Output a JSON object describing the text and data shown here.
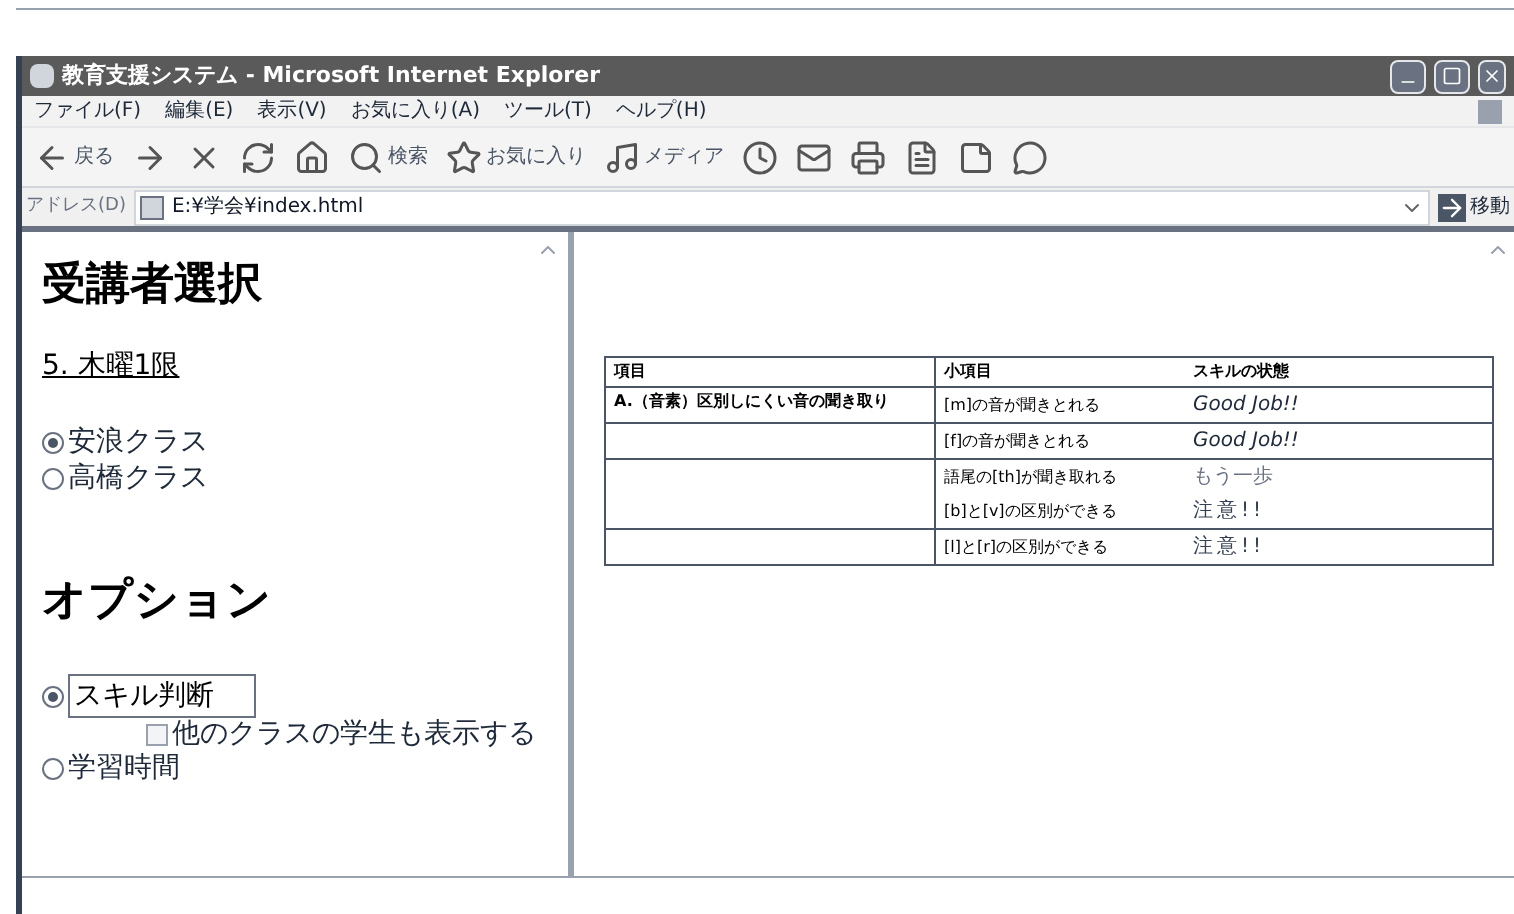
{
  "window": {
    "title": "教育支援システム - Microsoft Internet Explorer"
  },
  "menu": [
    "ファイル(F)",
    "編集(E)",
    "表示(V)",
    "お気に入り(A)",
    "ツール(T)",
    "ヘルプ(H)"
  ],
  "toolbar": [
    {
      "kind": "back",
      "label": "戻る"
    },
    {
      "kind": "forward"
    },
    {
      "kind": "stop"
    },
    {
      "kind": "refresh"
    },
    {
      "kind": "home"
    },
    {
      "kind": "search",
      "label": "検索"
    },
    {
      "kind": "favorites",
      "label": "お気に入り"
    },
    {
      "kind": "media",
      "label": "メディア"
    },
    {
      "kind": "history"
    },
    {
      "kind": "mail"
    },
    {
      "kind": "print"
    },
    {
      "kind": "edit"
    },
    {
      "kind": "note"
    },
    {
      "kind": "messenger"
    }
  ],
  "address": {
    "label": "アドレス(D)",
    "value": "E:¥学会¥index.html",
    "go": "移動"
  },
  "left": {
    "heading": "受講者選択",
    "period": "5. 木曜1限",
    "classes": [
      {
        "label": "安浪クラス",
        "selected": true
      },
      {
        "label": "高橋クラス",
        "selected": false
      }
    ],
    "options_heading": "オプション",
    "options": [
      {
        "label": "スキル判断",
        "selected": true,
        "sub": {
          "label": "他のクラスの学生も表示する",
          "checked": false
        }
      },
      {
        "label": "学習時間",
        "selected": false
      }
    ]
  },
  "table": {
    "columns": [
      "項目",
      "小項目",
      "スキルの状態"
    ],
    "groups": [
      {
        "item": "A.（音素）区別しにくい音の聞き取り",
        "rows": [
          {
            "sub": "[m]の音が聞きとれる",
            "status": "Good Job!!",
            "kind": "good"
          }
        ]
      },
      {
        "rows": [
          {
            "sub": "[f]の音が聞きとれる",
            "status": "Good Job!!",
            "kind": "good"
          }
        ]
      },
      {
        "rows": [
          {
            "sub": "語尾の[th]が聞き取れる",
            "status": "もう一歩",
            "kind": "faded"
          },
          {
            "sub": "[b]と[v]の区別ができる",
            "status": "注意!!",
            "kind": "warn"
          }
        ]
      },
      {
        "rows": [
          {
            "sub": "[l]と[r]の区別ができる",
            "status": "注意!!",
            "kind": "warn"
          }
        ]
      }
    ]
  }
}
